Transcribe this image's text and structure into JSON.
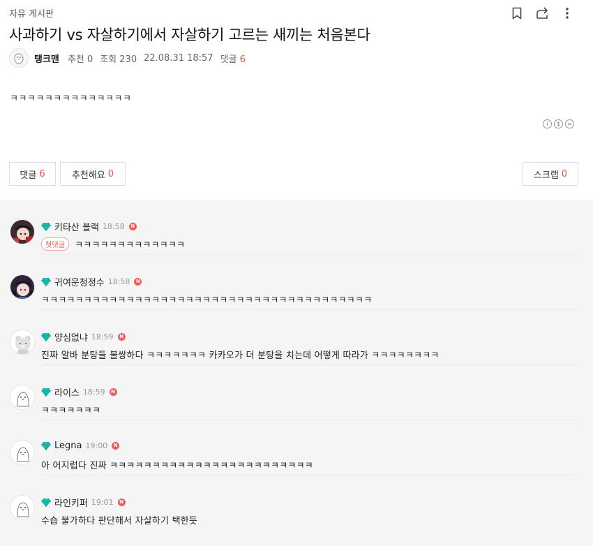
{
  "board": {
    "name": "자유 게시판"
  },
  "post": {
    "title": "사과하기 vs 자살하기에서 자살하기 고르는 새끼는 처음본다",
    "author": "탱크맨",
    "recommend_label": "추천 0",
    "views_label": "조회 230",
    "date": "22.08.31 18:57",
    "comment_label": "댓글",
    "comment_count": "6",
    "content": "ㅋㅋㅋㅋㅋㅋㅋㅋㅋㅋㅋㅋㅋㅋ"
  },
  "toolbar": {
    "icons": [
      "bookmark-icon",
      "share-icon",
      "more-vertical-icon"
    ]
  },
  "buttons": {
    "comment_label": "댓글",
    "comment_count": "6",
    "recommend_label": "추천해요",
    "recommend_count": "0",
    "scrap_label": "스크랩",
    "scrap_count": "0"
  },
  "license_icons": [
    "cc-by-icon",
    "cc-nc-icon",
    "cc-nd-icon"
  ],
  "comments": [
    {
      "nick": "키타산 블랙",
      "time": "18:58",
      "badge": "첫댓글",
      "text": "ㅋㅋㅋㅋㅋㅋㅋㅋㅋㅋㅋㅋㅋ"
    },
    {
      "nick": "귀여운청정수",
      "time": "18:58",
      "text": "ㅋㅋㅋㅋㅋㅋㅋㅋㅋㅋㅋㅋㅋㅋㅋㅋㅋㅋㅋㅋㅋㅋㅋㅋㅋㅋㅋㅋㅋㅋㅋㅋㅋㅋㅋㅋㅋㅋㅋ"
    },
    {
      "nick": "양심없냐",
      "time": "18:59",
      "text": "진짜 알바 분탕들 불쌍하다 ㅋㅋㅋㅋㅋㅋㅋ 카카오가 더 분탕을 치는데 어떻게 따라가 ㅋㅋㅋㅋㅋㅋㅋㅋ"
    },
    {
      "nick": "라이스",
      "time": "18:59",
      "text": "ㅋㅋㅋㅋㅋㅋㅋ"
    },
    {
      "nick": "Legna",
      "time": "19:00",
      "text": "아 어지럽다 진짜 ㅋㅋㅋㅋㅋㅋㅋㅋㅋㅋㅋㅋㅋㅋㅋㅋㅋㅋㅋㅋㅋㅋㅋㅋ"
    },
    {
      "nick": "라인키퍼",
      "time": "19:01",
      "text": "수습 불가하다 판단해서 자살하기 택한듯"
    }
  ],
  "colors": {
    "accent": "#e5534b",
    "gem": "#1fc0b4",
    "comment_bg": "#f5f5f5"
  }
}
